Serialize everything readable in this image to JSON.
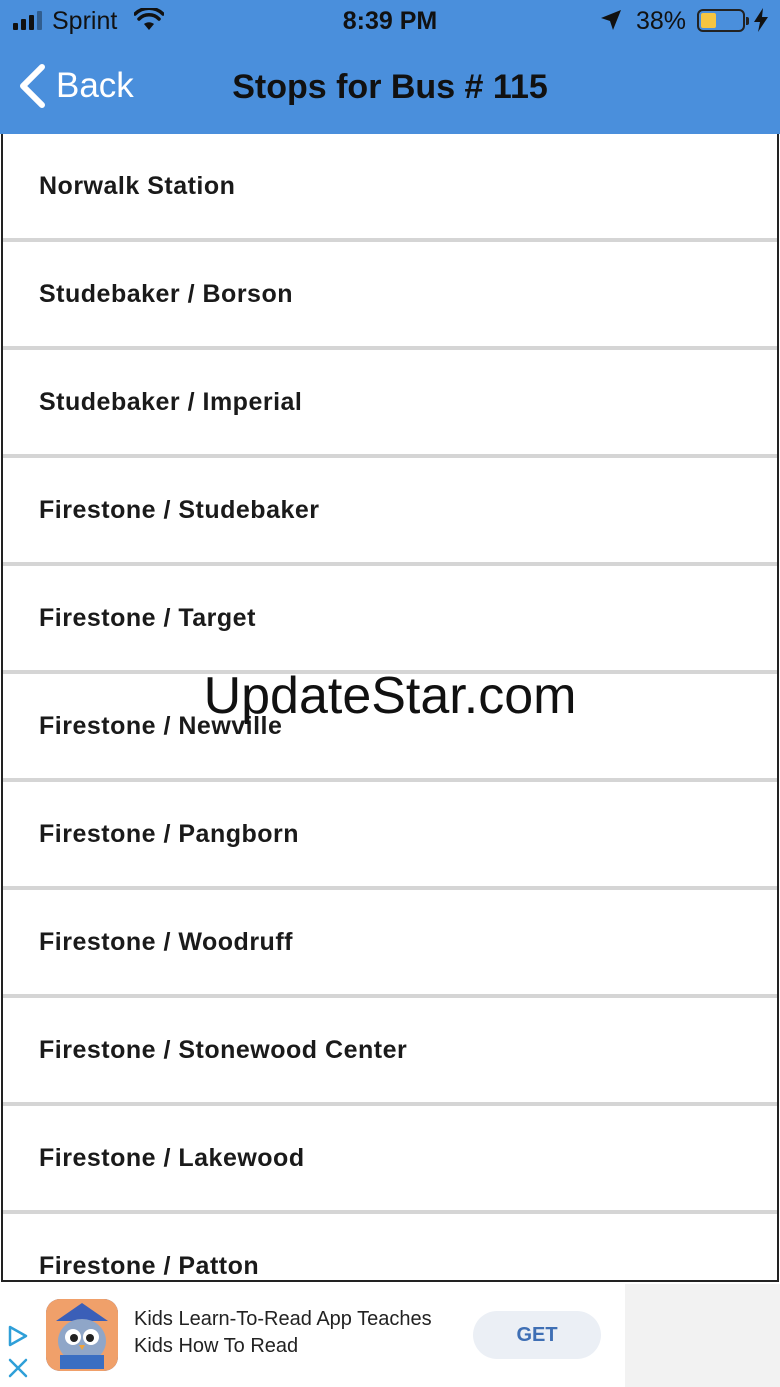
{
  "status_bar": {
    "carrier": "Sprint",
    "time": "8:39 PM",
    "battery_percent": "38%",
    "battery_level": 0.38
  },
  "nav": {
    "back_label": "Back",
    "title": "Stops for Bus # 115"
  },
  "stops": [
    "Norwalk Station",
    "Studebaker / Borson",
    "Studebaker / Imperial",
    "Firestone / Studebaker",
    "Firestone / Target",
    "Firestone / Newville",
    "Firestone / Pangborn",
    "Firestone / Woodruff",
    "Firestone / Stonewood Center",
    "Firestone / Lakewood",
    "Firestone / Patton"
  ],
  "watermark": "UpdateStar.com",
  "ad": {
    "text_line1": "Kids Learn-To-Read App Teaches",
    "text_line2": "Kids How To Read",
    "cta_label": "GET"
  },
  "colors": {
    "header": "#4a8fdc",
    "cta_text": "#3f6fb4"
  },
  "icons": [
    "signal-icon",
    "wifi-icon",
    "location-arrow-icon",
    "battery-icon",
    "charging-bolt-icon",
    "back-chevron-icon",
    "ad-choices-icon",
    "close-icon",
    "app-icon"
  ]
}
